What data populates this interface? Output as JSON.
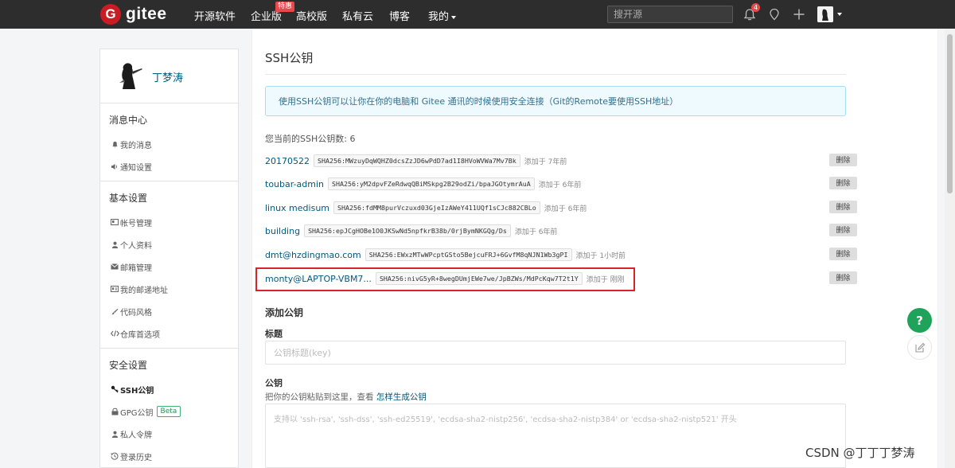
{
  "nav": {
    "logo_letter": "G",
    "logo_text": "gitee",
    "items": [
      "开源软件",
      "企业版",
      "高校版",
      "私有云",
      "博客",
      "我的"
    ],
    "badge": "特惠",
    "search_placeholder": "搜开源",
    "notification_count": "4"
  },
  "sidebar": {
    "user_name": "丁梦涛",
    "sections": [
      {
        "title": "消息中心",
        "items": [
          "我的消息",
          "通知设置"
        ]
      },
      {
        "title": "基本设置",
        "items": [
          "帐号管理",
          "个人资料",
          "邮箱管理",
          "我的邮递地址",
          "代码风格",
          "仓库首选项"
        ]
      },
      {
        "title": "安全设置",
        "items": [
          "SSH公钥",
          "GPG公钥",
          "私人令牌",
          "登录历史"
        ]
      }
    ],
    "beta_label": "Beta"
  },
  "main": {
    "title": "SSH公钥",
    "info": "使用SSH公钥可以让你在你的电脑和 Gitee 通讯的时候使用安全连接（Git的Remote要使用SSH地址）",
    "count_text": "您当前的SSH公钥数: 6",
    "delete_label": "删除",
    "keys": [
      {
        "name": "20170522",
        "fingerprint": "SHA256:MWzuyDqWQHZ0dcsZzJD6wPdD7ad1I8HVoWVWa7Mv7Bk",
        "time": "添加于 7年前"
      },
      {
        "name": "toubar-admin",
        "fingerprint": "SHA256:yM2dpvFZeRdwqQBiMSkpg2B29odZi/bpaJGOtymrAuA",
        "time": "添加于 6年前"
      },
      {
        "name": "linux medisum",
        "fingerprint": "SHA256:fdMM8purVczuxd03GjeIzAWeY411UQf1sCJc882CBLo",
        "time": "添加于 6年前"
      },
      {
        "name": "building",
        "fingerprint": "SHA256:epJCgHOBe1O0JKSwNd5npfkrB38b/0rjBymNKGQg/Ds",
        "time": "添加于 6年前"
      },
      {
        "name": "dmt@hzdingmao.com",
        "fingerprint": "SHA256:EWxzMTwWPcptGSto5BejcuFRJ+6GvfM8qNJN1Wb3gPI",
        "time": "添加于 1小时前"
      },
      {
        "name": "monty@LAPTOP-VBM7...",
        "fingerprint": "SHA256:nivG5yR+8wegDUmjEWe7we/JpBZWs/MdPcKqw7T2t1Y",
        "time": "添加于 刚刚"
      }
    ],
    "add_title": "添加公钥",
    "label_title": "标题",
    "title_placeholder": "公钥标题(key)",
    "label_key": "公钥",
    "key_hint": "把你的公钥粘贴到这里，查看",
    "key_hint_link": "怎样生成公钥",
    "key_placeholder": "支持以 'ssh-rsa', 'ssh-dss', 'ssh-ed25519', 'ecdsa-sha2-nistp256', 'ecdsa-sha2-nistp384' or 'ecdsa-sha2-nistp521' 开头"
  },
  "help_label": "?",
  "watermark": "CSDN @丁丁丁梦涛",
  "colors": {
    "brand": "#c71d23",
    "link": "#005980",
    "help": "#1fa35a",
    "highlight": "#d8232a"
  }
}
